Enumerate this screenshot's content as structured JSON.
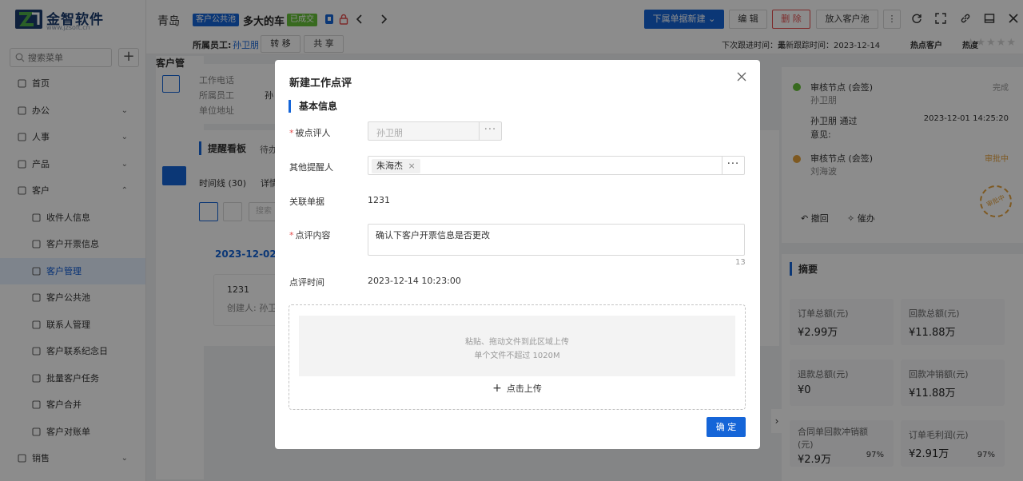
{
  "colors": {
    "primary": "#1565d8",
    "danger": "#e34d4d",
    "success": "#67c23a",
    "pending": "#e6a23c"
  },
  "sidebar": {
    "logo_name": "金智软件",
    "logo_url": "www.jzsoft.cn",
    "search_placeholder": "搜索菜单",
    "items": [
      {
        "label": "首页",
        "icon": "home-icon",
        "chevron": ""
      },
      {
        "label": "办公",
        "icon": "office-icon",
        "chevron": "⌄"
      },
      {
        "label": "人事",
        "icon": "people-icon",
        "chevron": "⌄"
      },
      {
        "label": "产品",
        "icon": "product-icon",
        "chevron": "⌄"
      },
      {
        "label": "客户",
        "icon": "customer-icon",
        "chevron": "⌃",
        "expanded": true
      },
      {
        "label": "收件人信息",
        "icon": "sound-icon",
        "sub": true
      },
      {
        "label": "客户开票信息",
        "icon": "sound-icon",
        "sub": true
      },
      {
        "label": "客户管理",
        "icon": "chart-icon",
        "sub": true,
        "active": true
      },
      {
        "label": "客户公共池",
        "icon": "pool-icon",
        "sub": true
      },
      {
        "label": "联系人管理",
        "icon": "contact-icon",
        "sub": true
      },
      {
        "label": "客户联系纪念日",
        "icon": "calendar-icon",
        "sub": true
      },
      {
        "label": "批量客户任务",
        "icon": "task-icon",
        "sub": true
      },
      {
        "label": "客户合并",
        "icon": "merge-icon",
        "sub": true
      },
      {
        "label": "客户对账单",
        "icon": "statement-icon",
        "sub": true
      },
      {
        "label": "销售",
        "icon": "sales-icon",
        "chevron": "⌄"
      }
    ]
  },
  "topbar": {
    "breadcrumb": "青岛",
    "tag_pool": "客户公共池",
    "title": "多大的车",
    "tag_closed": "已成交",
    "btn_new_doc": "下属单据新建 ⌄",
    "btn_edit": "编 辑",
    "btn_delete": "删 除",
    "btn_to_pool": "放入客户池",
    "btn_more": "⋮"
  },
  "subbar": {
    "owner_label": "所属员工:",
    "owner_name": "孙卫朋",
    "btn_transfer": "转 移",
    "btn_share": "共 享",
    "next_follow": "下次跟进时间：无",
    "last_follow": "最新跟踪时间：2023-12-14",
    "hot_label": "热点客户",
    "heat_label": "热度",
    "stars": "★★★★★"
  },
  "background": {
    "section_title": "客户管",
    "info_rows": [
      "工作电话",
      "所属员工",
      "单位地址"
    ],
    "info_value_owner": "孙",
    "board_title": "提醒看板",
    "board_tab": "待办",
    "tab_timeline": "时间线 (30)",
    "tab_detail": "详情",
    "search_placeholder": "搜索",
    "date": "2023-12-02",
    "card_id": "1231",
    "card_creator": "创建人: 孙卫",
    "right_edge": "t"
  },
  "approval": {
    "node1_title": "审核节点 (会签)",
    "node1_user": "孙卫朋",
    "node1_status": "完成",
    "node1_detail": "孙卫朋 通过",
    "node1_time": "2023-12-01 14:25:20",
    "node1_opinion": "意见:",
    "node2_title": "审核节点 (会签)",
    "node2_user": "刘海波",
    "node2_status": "审批中",
    "stamp_text": "审批中",
    "btn_revoke": "撤回",
    "btn_urge": "催办"
  },
  "summary": {
    "title": "摘要",
    "cards": [
      {
        "label": "订单总额(元)",
        "value": "¥2.99万"
      },
      {
        "label": "回款总额(元)",
        "value": "¥11.88万"
      },
      {
        "label": "退款总额(元)",
        "value": "¥0"
      },
      {
        "label": "回款冲销额(元)",
        "value": "¥11.88万"
      },
      {
        "label": "合同单回款冲销额(元)",
        "value": "¥2.9万",
        "pct": "97%"
      },
      {
        "label": "订单毛利润(元)",
        "value": "¥2.91万",
        "pct": "97%"
      }
    ]
  },
  "modal": {
    "title": "新建工作点评",
    "section": "基本信息",
    "reviewee_label": "被点评人",
    "reviewee_value": "孙卫朋",
    "other_label": "其他提醒人",
    "other_chip": "朱海杰",
    "related_label": "关联单据",
    "related_value": "1231",
    "content_label": "点评内容",
    "content_value": "确认下客户开票信息是否更改",
    "char_count": "13",
    "time_label": "点评时间",
    "time_value": "2023-12-14 10:23:00",
    "upload_line1": "粘贴、拖动文件到此区域上传",
    "upload_line2": "单个文件不超过 1020M",
    "upload_btn": "点击上传",
    "ok_btn": "确 定"
  }
}
